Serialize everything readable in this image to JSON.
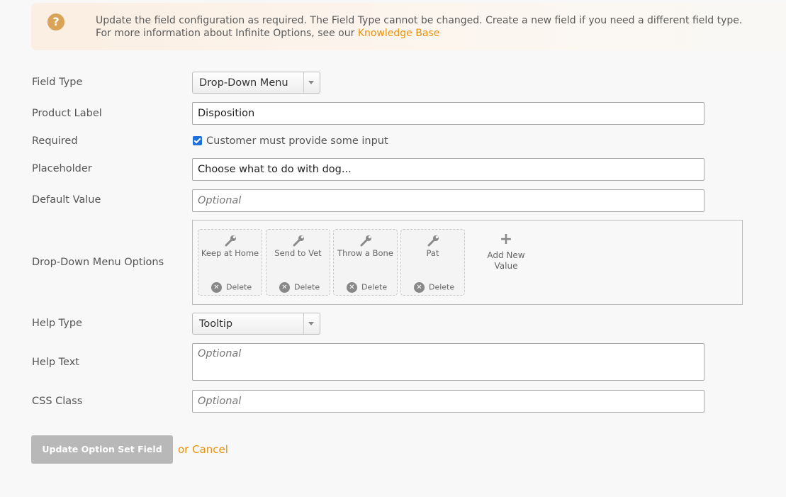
{
  "notice": {
    "line1": "Update the field configuration as required. The Field Type cannot be changed. Create a new field if you need a different field type.",
    "line2_prefix": "For more information about Infinite Options, see our ",
    "link_text": "Knowledge Base"
  },
  "fields": {
    "field_type": {
      "label": "Field Type",
      "value": "Drop-Down Menu"
    },
    "product_label": {
      "label": "Product Label",
      "value": "Disposition"
    },
    "required": {
      "label": "Required",
      "checkbox_label": "Customer must provide some input",
      "checked": true
    },
    "placeholder": {
      "label": "Placeholder",
      "value": "Choose what to do with dog..."
    },
    "default_value": {
      "label": "Default Value",
      "placeholder": "Optional"
    },
    "dropdown_options": {
      "label": "Drop-Down Menu Options",
      "options": [
        {
          "label": "Keep at Home",
          "delete": "Delete"
        },
        {
          "label": "Send to Vet",
          "delete": "Delete"
        },
        {
          "label": "Throw a Bone",
          "delete": "Delete"
        },
        {
          "label": "Pat",
          "delete": "Delete"
        }
      ],
      "add_new_line1": "Add New",
      "add_new_line2": "Value"
    },
    "help_type": {
      "label": "Help Type",
      "value": "Tooltip"
    },
    "help_text": {
      "label": "Help Text",
      "placeholder": "Optional"
    },
    "css_class": {
      "label": "CSS Class",
      "placeholder": "Optional"
    }
  },
  "actions": {
    "update": "Update Option Set Field",
    "or": "or ",
    "cancel": "Cancel"
  },
  "colors": {
    "accent": "#e8910c",
    "checkbox": "#1e6fd9",
    "button_disabled": "#b8b8b8"
  }
}
